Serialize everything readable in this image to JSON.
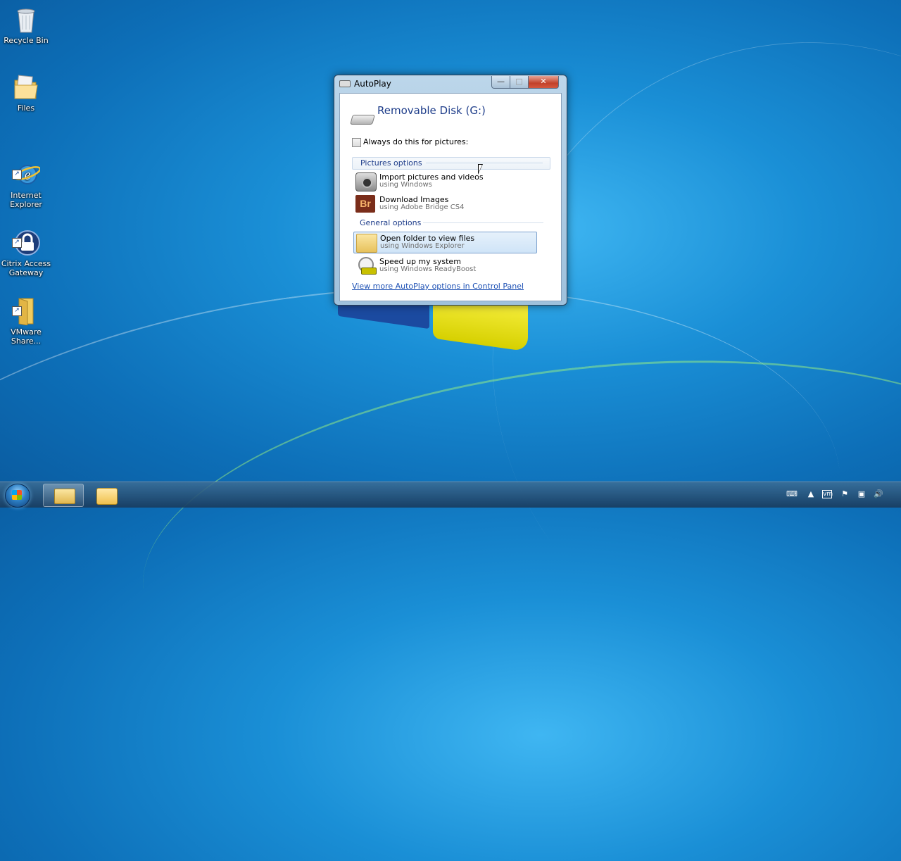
{
  "desktop": {
    "icons": [
      {
        "label": "Recycle Bin"
      },
      {
        "label": "Files"
      },
      {
        "label": "Internet\nExplorer"
      },
      {
        "label": "Citrix Access\nGateway"
      },
      {
        "label": "VMware\nShare..."
      }
    ]
  },
  "dialog": {
    "title": "AutoPlay",
    "drive_title": "Removable Disk (G:)",
    "always_label": "Always do this for pictures:",
    "always_checked": false,
    "pictures_header": "Pictures options",
    "general_header": "General options",
    "options": [
      {
        "title": "Import pictures and videos",
        "subtitle": "using Windows",
        "icon": "camera-icon"
      },
      {
        "title": "Download Images",
        "subtitle": "using Adobe Bridge CS4",
        "icon": "adobe-bridge-icon",
        "icon_text": "Br"
      },
      {
        "title": "Open folder to view files",
        "subtitle": "using Windows Explorer",
        "icon": "folder-icon",
        "selected": true
      },
      {
        "title": "Speed up my system",
        "subtitle": "using Windows ReadyBoost",
        "icon": "readyboost-icon"
      }
    ],
    "control_panel_link": "View more AutoPlay options in Control Panel",
    "buttons": {
      "minimize": "—",
      "maximize": "□",
      "close": "✕"
    }
  },
  "taskbar": {
    "start": "start-orb",
    "pinned": [
      "windows-explorer",
      "outlook"
    ],
    "tray_icons": [
      "keyboard-icon",
      "show-hidden-icon",
      "vmware-icon",
      "flag-icon",
      "network-icon",
      "volume-icon"
    ]
  },
  "colors": {
    "link": "#1c50b4",
    "header_text": "#1e3d8a",
    "selection": "#cfe4f7"
  }
}
